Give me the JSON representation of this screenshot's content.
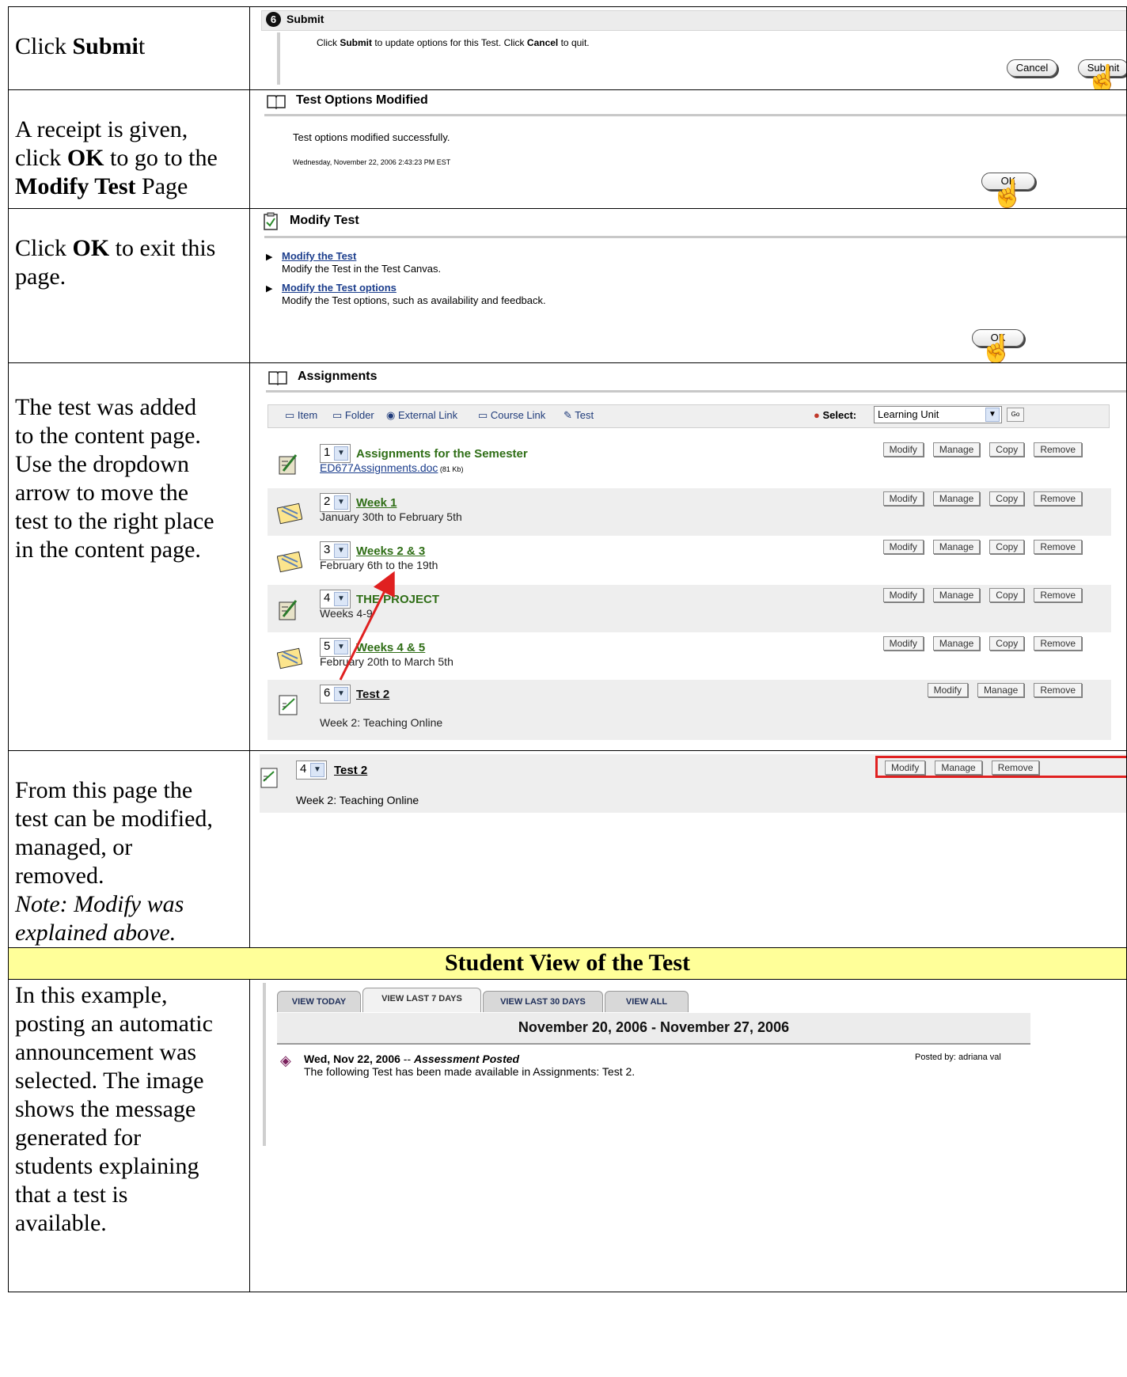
{
  "rows": [
    {
      "left": [
        {
          "text": "Click "
        },
        {
          "text": "Submi",
          "bold": true
        },
        {
          "text": "t"
        }
      ],
      "submit": {
        "number": "6",
        "title": "Submit",
        "instr_a": "Click ",
        "instr_submit": "Submit",
        "instr_b": " to update options for this Test. Click ",
        "instr_cancel": "Cancel",
        "instr_c": " to quit.",
        "cancel_label": "Cancel",
        "submit_label": "Submit"
      }
    },
    {
      "left_lines": [
        [
          {
            "text": "A receipt is given,"
          }
        ],
        [
          {
            "text": "click "
          },
          {
            "text": "OK",
            "bold": true
          },
          {
            "text": " to go to the"
          }
        ],
        [
          {
            "text": "Modify Test",
            "bold": true
          },
          {
            "text": " Page"
          }
        ]
      ],
      "receipt": {
        "title": "Test Options Modified",
        "message": "Test options modified successfully.",
        "timestamp": "Wednesday, November 22, 2006 2:43:23 PM EST",
        "ok_label": "OK"
      }
    },
    {
      "left_lines": [
        [
          {
            "text": "Click "
          },
          {
            "text": "OK",
            "bold": true
          },
          {
            "text": " to exit this"
          }
        ],
        [
          {
            "text": "page."
          }
        ]
      ],
      "modify": {
        "title": "Modify Test",
        "links": [
          {
            "label": "Modify the Test",
            "desc": "Modify the Test in the Test Canvas."
          },
          {
            "label": "Modify the Test options",
            "desc": "Modify the Test options, such as availability and feedback."
          }
        ],
        "ok_label": "OK"
      }
    },
    {
      "left_lines": [
        [
          {
            "text": "The test was added"
          }
        ],
        [
          {
            "text": "to the content page."
          }
        ],
        [
          {
            "text": "Use the dropdown"
          }
        ],
        [
          {
            "text": "arrow to move the"
          }
        ],
        [
          {
            "text": "test to the right place"
          }
        ],
        [
          {
            "text": "in the content page."
          }
        ]
      ],
      "assignments": {
        "title": "Assignments",
        "toolbar": [
          "Item",
          "Folder",
          "External Link",
          "Course Link",
          "Test"
        ],
        "select_label": "Select:",
        "select_value": "Learning Unit",
        "go_label": "Go",
        "items": [
          {
            "num": "1",
            "title": "Assignments for the Semester",
            "underline": false,
            "link": "ED677Assignments.doc",
            "size": "(81 Kb)",
            "desc": "",
            "buttons": [
              "Modify",
              "Manage",
              "Copy",
              "Remove"
            ],
            "icon": "doc-icon"
          },
          {
            "num": "2",
            "title": "Week 1",
            "underline": true,
            "desc": "January 30th to February 5th",
            "buttons": [
              "Modify",
              "Manage",
              "Copy",
              "Remove"
            ],
            "icon": "folder-icon"
          },
          {
            "num": "3",
            "title": "Weeks 2 & 3",
            "underline": true,
            "desc": "February 6th to the 19th",
            "buttons": [
              "Modify",
              "Manage",
              "Copy",
              "Remove"
            ],
            "icon": "folder-icon"
          },
          {
            "num": "4",
            "title": "THE PROJECT",
            "underline": false,
            "desc": "Weeks 4-9",
            "buttons": [
              "Modify",
              "Manage",
              "Copy",
              "Remove"
            ],
            "icon": "doc-icon"
          },
          {
            "num": "5",
            "title": "Weeks 4 & 5",
            "underline": true,
            "desc": "February 20th  to March 5th",
            "buttons": [
              "Modify",
              "Manage",
              "Copy",
              "Remove"
            ],
            "icon": "folder-icon"
          },
          {
            "num": "6",
            "title": "Test 2",
            "underline": true,
            "desc": "Week 2: Teaching Online",
            "buttons": [
              "Modify",
              "Manage",
              "Remove"
            ],
            "icon": "test-icon"
          }
        ]
      }
    },
    {
      "left_lines": [
        [
          {
            "text": "From this page the"
          }
        ],
        [
          {
            "text": "test can be modified,"
          }
        ],
        [
          {
            "text": "managed, or"
          }
        ],
        [
          {
            "text": "removed."
          }
        ],
        [
          {
            "text": "Note: Modify was",
            "italic": true
          }
        ],
        [
          {
            "text": "explained above.",
            "italic": true
          }
        ]
      ],
      "test_row": {
        "num": "4",
        "title": "Test 2",
        "desc": "Week 2: Teaching Online",
        "buttons": [
          "Modify",
          "Manage",
          "Remove"
        ]
      }
    }
  ],
  "section_header": "Student View of the Test",
  "student": {
    "left_lines": [
      [
        {
          "text": "In this example,"
        }
      ],
      [
        {
          "text": "posting an automatic"
        }
      ],
      [
        {
          "text": "announcement was"
        }
      ],
      [
        {
          "text": "selected. The image"
        }
      ],
      [
        {
          "text": "shows the message"
        }
      ],
      [
        {
          "text": "generated for"
        }
      ],
      [
        {
          "text": "students explaining"
        }
      ],
      [
        {
          "text": "that a test is"
        }
      ],
      [
        {
          "text": "available."
        }
      ]
    ],
    "tabs": [
      "VIEW TODAY",
      "VIEW LAST 7 DAYS",
      "VIEW LAST 30 DAYS",
      "VIEW ALL"
    ],
    "date_range": "November 20, 2006 - November 27, 2006",
    "ann_date": "Wed, Nov 22, 2006",
    "ann_sep": " -- ",
    "ann_title": "Assessment Posted",
    "ann_posted_by": "Posted by: adriana val",
    "ann_body": "The following Test has been made available in Assignments: Test 2."
  },
  "colors": {
    "section_bg": "#ffff99",
    "highlight_box": "#e02020",
    "arrow": "#e02020",
    "title_green": "#2f6e16"
  }
}
